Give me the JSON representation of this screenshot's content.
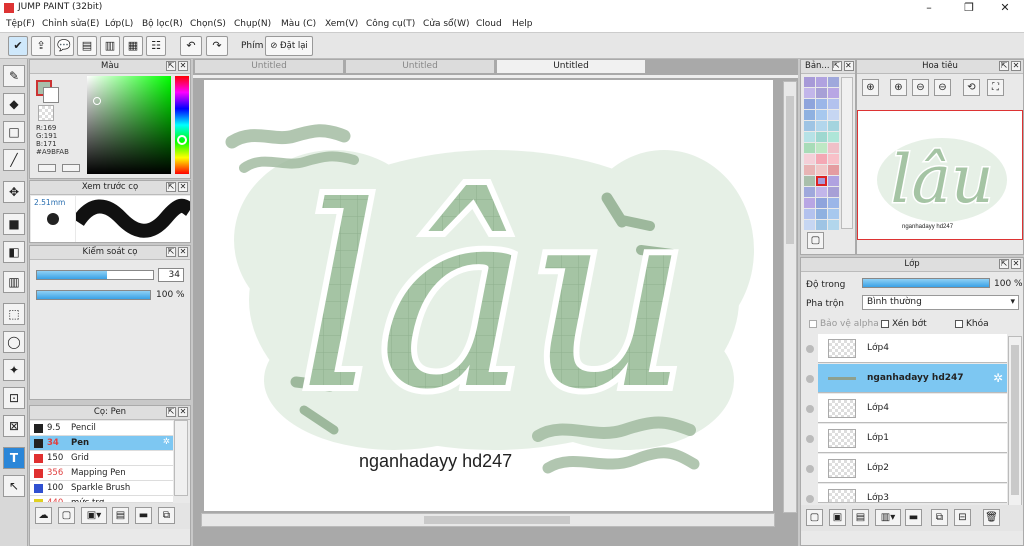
{
  "app": {
    "title": "JUMP PAINT (32bit)"
  },
  "menu": [
    "Tệp(F)",
    "Chỉnh sửa(E)",
    "Lớp(L)",
    "Bộ lọc(R)",
    "Chọn(S)",
    "Chụp(N)",
    "Màu (C)",
    "Xem(V)",
    "Công cụ(T)",
    "Cửa sổ(W)",
    "Cloud",
    "Help"
  ],
  "toolbar": {
    "key_label": "Phím",
    "reset_label": "Đặt lại"
  },
  "color_panel": {
    "title": "Màu",
    "r": "R:169",
    "g": "G:191",
    "b": "B:171",
    "hex": "#A9BFAB",
    "current_color": "#A9BFAB"
  },
  "preview_panel": {
    "title": "Xem trước cọ",
    "size": "2.51mm"
  },
  "brush_control": {
    "title": "Kiểm soát cọ",
    "size_value": "34",
    "opacity_value": "100 %",
    "size_fill": 0.6,
    "opacity_fill": 1.0
  },
  "brush_list": {
    "title": "Cọ: Pen",
    "items": [
      {
        "size": "9.5",
        "name": "Pencil",
        "color": "#222222",
        "size_color": "#222222"
      },
      {
        "size": "34",
        "name": "Pen",
        "color": "#222222",
        "size_color": "#e04040"
      },
      {
        "size": "150",
        "name": "Grid",
        "color": "#e03030",
        "size_color": "#222222"
      },
      {
        "size": "356",
        "name": "Mapping Pen",
        "color": "#e03030",
        "size_color": "#e04040"
      },
      {
        "size": "100",
        "name": "Sparkle Brush",
        "color": "#3050d0",
        "size_color": "#222222"
      },
      {
        "size": "440",
        "name": "mức trơ",
        "color": "#e0d020",
        "size_color": "#e04040"
      }
    ]
  },
  "tabs": [
    "Untitled",
    "Untitled",
    "Untitled"
  ],
  "canvas": {
    "main_text": "lâu",
    "signature": "nganhadayy hd247",
    "thumb_signature": "nganhadayy hd247"
  },
  "palette_panel": {
    "title": "Bản..."
  },
  "navigator": {
    "title": "Hoa tiêu"
  },
  "layers": {
    "title": "Lớp",
    "opacity_label": "Độ trong",
    "opacity_value": "100 %",
    "blend_label": "Pha trộn",
    "blend_value": "Bình thường",
    "alpha_label": "Bảo vệ alpha",
    "clip_label": "Xén bớt",
    "lock_label": "Khóa",
    "items": [
      {
        "name": "Lớp4",
        "selected": false
      },
      {
        "name": "nganhadayy hd247",
        "selected": true
      },
      {
        "name": "Lớp4",
        "selected": false
      },
      {
        "name": "Lớp1",
        "selected": false
      },
      {
        "name": "Lớp2",
        "selected": false
      },
      {
        "name": "Lớp3",
        "selected": false
      }
    ]
  }
}
